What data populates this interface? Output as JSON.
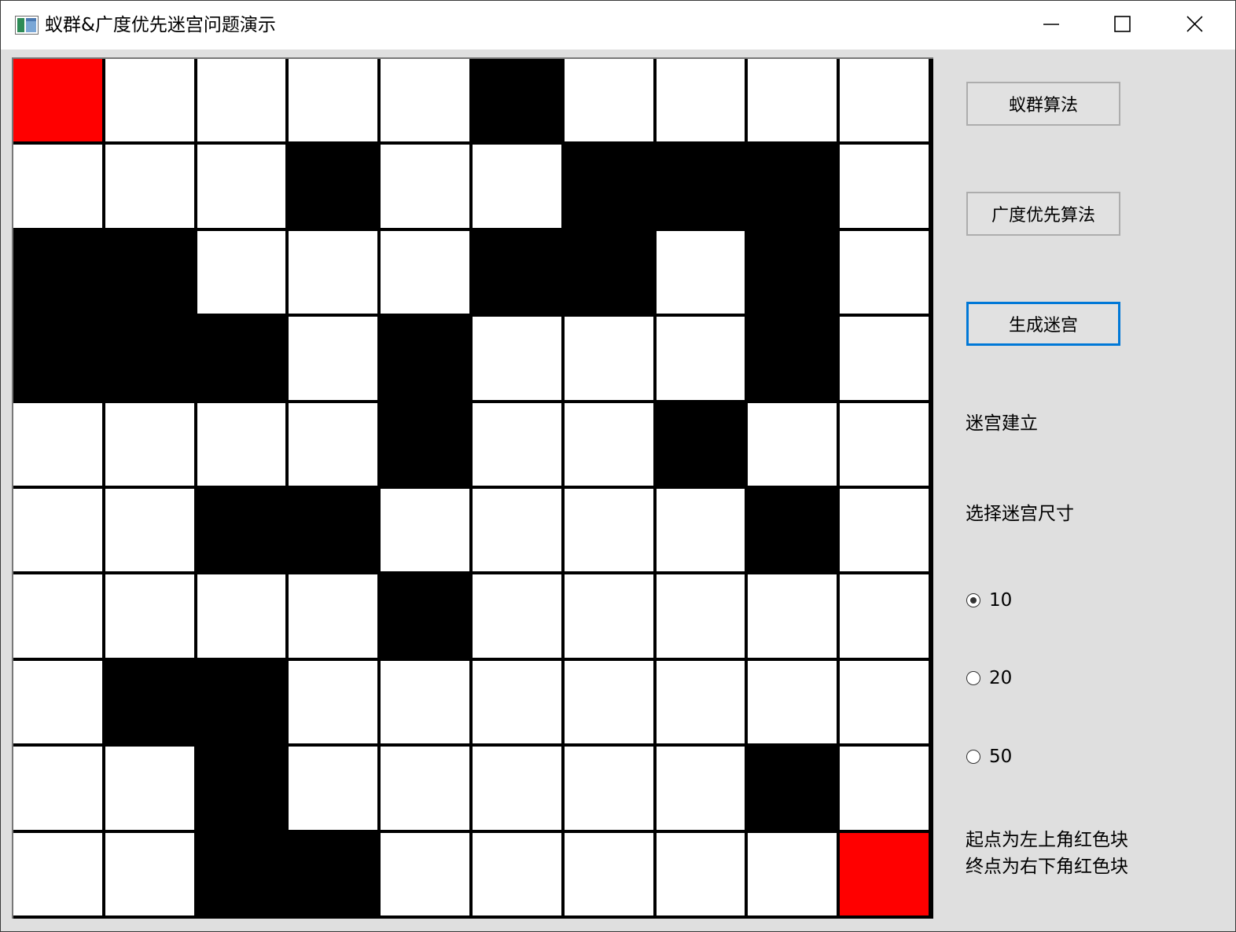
{
  "window": {
    "title": "蚁群&广度优先迷宫问题演示",
    "minimize_symbol": "—",
    "maximize_symbol": "☐",
    "close_symbol": "✕"
  },
  "buttons": {
    "ant_colony": "蚁群算法",
    "bfs": "广度优先算法",
    "generate": "生成迷宫"
  },
  "status_text": "迷宫建立",
  "size_label": "选择迷宫尺寸",
  "size_options": [
    {
      "label": "10",
      "checked": true
    },
    {
      "label": "20",
      "checked": false
    },
    {
      "label": "50",
      "checked": false
    }
  ],
  "note": {
    "line1": "起点为左上角红色块",
    "line2": "终点为右下角红色块"
  },
  "colors": {
    "open": "#ffffff",
    "wall": "#000000",
    "start_end": "#ff0000",
    "focus": "#0078d7"
  },
  "maze": {
    "size": 10,
    "legend": "S=start, E=end, 1=wall, 0=open",
    "rows": [
      [
        "S",
        "0",
        "0",
        "0",
        "0",
        "1",
        "0",
        "0",
        "0",
        "0"
      ],
      [
        "0",
        "0",
        "0",
        "1",
        "0",
        "0",
        "1",
        "1",
        "1",
        "0"
      ],
      [
        "1",
        "1",
        "0",
        "0",
        "0",
        "1",
        "1",
        "0",
        "1",
        "0"
      ],
      [
        "1",
        "1",
        "1",
        "0",
        "1",
        "0",
        "0",
        "0",
        "1",
        "0"
      ],
      [
        "0",
        "0",
        "0",
        "0",
        "1",
        "0",
        "0",
        "1",
        "0",
        "0"
      ],
      [
        "0",
        "0",
        "1",
        "1",
        "0",
        "0",
        "0",
        "0",
        "1",
        "0"
      ],
      [
        "0",
        "0",
        "0",
        "0",
        "1",
        "0",
        "0",
        "0",
        "0",
        "0"
      ],
      [
        "0",
        "1",
        "1",
        "0",
        "0",
        "0",
        "0",
        "0",
        "0",
        "0"
      ],
      [
        "0",
        "0",
        "1",
        "0",
        "0",
        "0",
        "0",
        "0",
        "1",
        "0"
      ],
      [
        "0",
        "0",
        "1",
        "1",
        "0",
        "0",
        "0",
        "0",
        "0",
        "E"
      ]
    ]
  }
}
